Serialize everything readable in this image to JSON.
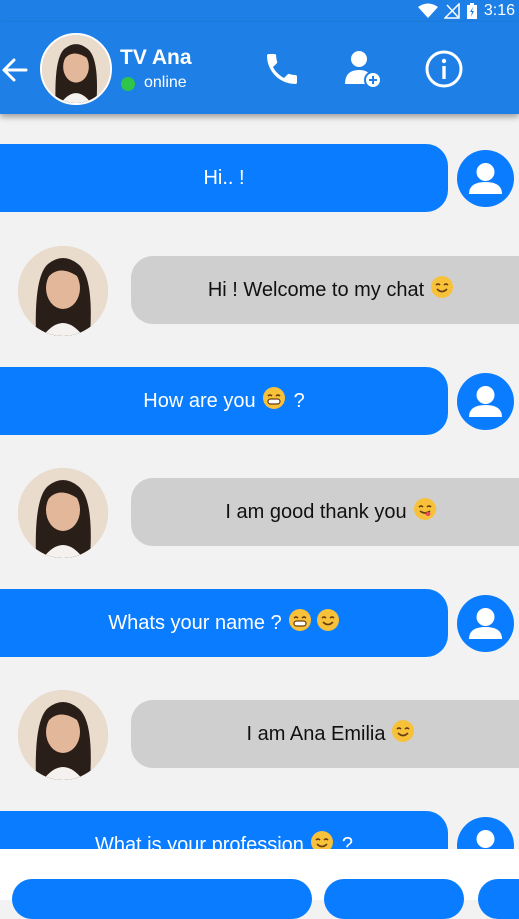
{
  "status_bar": {
    "time": "3:16"
  },
  "header": {
    "contact_name": "TV Ana",
    "status_text": "online",
    "icons": [
      "back-arrow-icon",
      "phone-icon",
      "add-contact-icon",
      "info-icon"
    ],
    "colors": {
      "bar": "#1e7fe6",
      "online": "#2fc44a"
    }
  },
  "messages": [
    {
      "sender": "user",
      "text": "Hi.. !",
      "emojis": []
    },
    {
      "sender": "contact",
      "text": "Hi ! Welcome to my chat",
      "emojis": [
        "smile"
      ]
    },
    {
      "sender": "user",
      "text": "How are you",
      "emojis": [
        "grin"
      ],
      "suffix": "?"
    },
    {
      "sender": "contact",
      "text": "I am good thank you",
      "emojis": [
        "yum"
      ]
    },
    {
      "sender": "user",
      "text": "Whats your name ?",
      "emojis": [
        "grin",
        "smile"
      ]
    },
    {
      "sender": "contact",
      "text": "I am Ana Emilia",
      "emojis": [
        "smile"
      ]
    },
    {
      "sender": "user",
      "text": "What is your profession",
      "emojis": [
        "smile"
      ],
      "suffix": "?"
    }
  ],
  "colors": {
    "outgoing": "#0a7cff",
    "incoming": "#cfcfcf",
    "background": "#f2f2f2"
  }
}
